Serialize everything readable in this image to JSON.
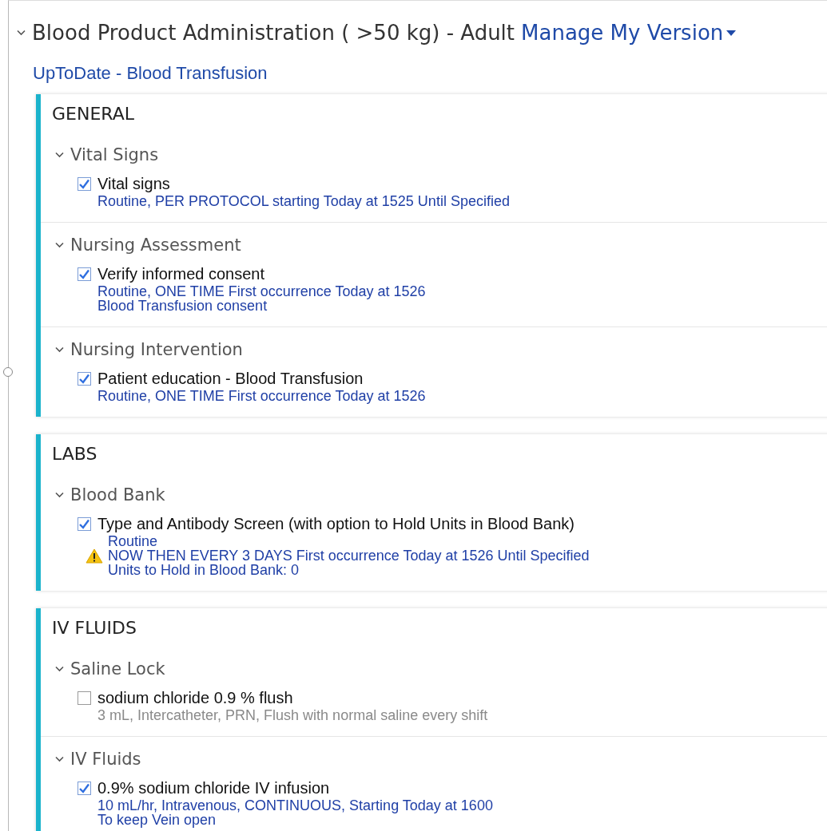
{
  "header": {
    "title": "Blood Product Administration ( >50 kg) - Adult",
    "manage": "Manage My Version",
    "expanded": true
  },
  "link": "UpToDate - Blood Transfusion",
  "sections": [
    {
      "title": "GENERAL",
      "groups": [
        {
          "title": "Vital Signs",
          "expanded": true,
          "orders": [
            {
              "name": "Vital signs",
              "checked": true,
              "warning": false,
              "details": [
                "Routine, PER PROTOCOL starting Today at 1525 Until Specified"
              ]
            }
          ]
        },
        {
          "title": "Nursing Assessment",
          "expanded": true,
          "orders": [
            {
              "name": "Verify informed consent",
              "checked": true,
              "warning": false,
              "details": [
                "Routine, ONE TIME First occurrence Today at 1526",
                "Blood Transfusion consent"
              ]
            }
          ]
        },
        {
          "title": "Nursing Intervention",
          "expanded": true,
          "orders": [
            {
              "name": "Patient education - Blood Transfusion",
              "checked": true,
              "warning": false,
              "details": [
                "Routine, ONE TIME First occurrence Today at 1526"
              ]
            }
          ]
        }
      ]
    },
    {
      "title": "LABS",
      "groups": [
        {
          "title": "Blood Bank",
          "expanded": true,
          "orders": [
            {
              "name": "Type and Antibody Screen (with option to Hold Units in Blood Bank)",
              "checked": true,
              "warning": true,
              "details": [
                "Routine",
                "NOW THEN EVERY 3 DAYS First occurrence Today at 1526 Until Specified",
                "Units to Hold in Blood Bank: 0"
              ]
            }
          ]
        }
      ]
    },
    {
      "title": "IV FLUIDS",
      "groups": [
        {
          "title": "Saline Lock",
          "expanded": true,
          "orders": [
            {
              "name": "sodium chloride 0.9 % flush",
              "checked": false,
              "warning": false,
              "details": [
                "3 mL, Intercatheter, PRN, Flush with normal saline every shift"
              ]
            }
          ]
        },
        {
          "title": "IV Fluids",
          "expanded": true,
          "orders": [
            {
              "name": "0.9% sodium chloride IV infusion",
              "checked": true,
              "warning": false,
              "details": [
                "10 mL/hr, Intravenous, CONTINUOUS, Starting Today at 1600",
                "To keep Vein open"
              ]
            }
          ]
        }
      ]
    }
  ]
}
